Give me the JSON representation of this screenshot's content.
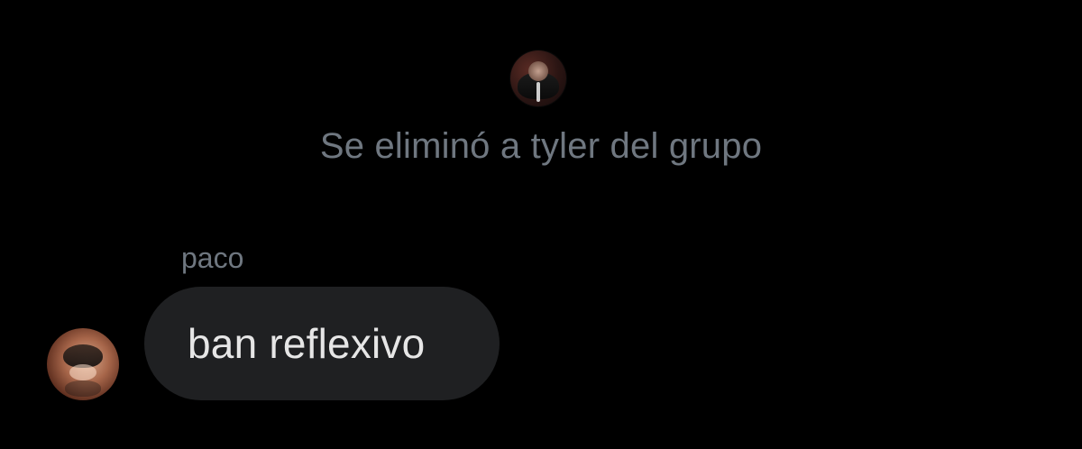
{
  "system_event": {
    "text": "Se eliminó a tyler del grupo",
    "avatar_icon": "profile-avatar"
  },
  "message": {
    "sender": "paco",
    "text": "ban reflexivo",
    "avatar_icon": "profile-avatar"
  }
}
